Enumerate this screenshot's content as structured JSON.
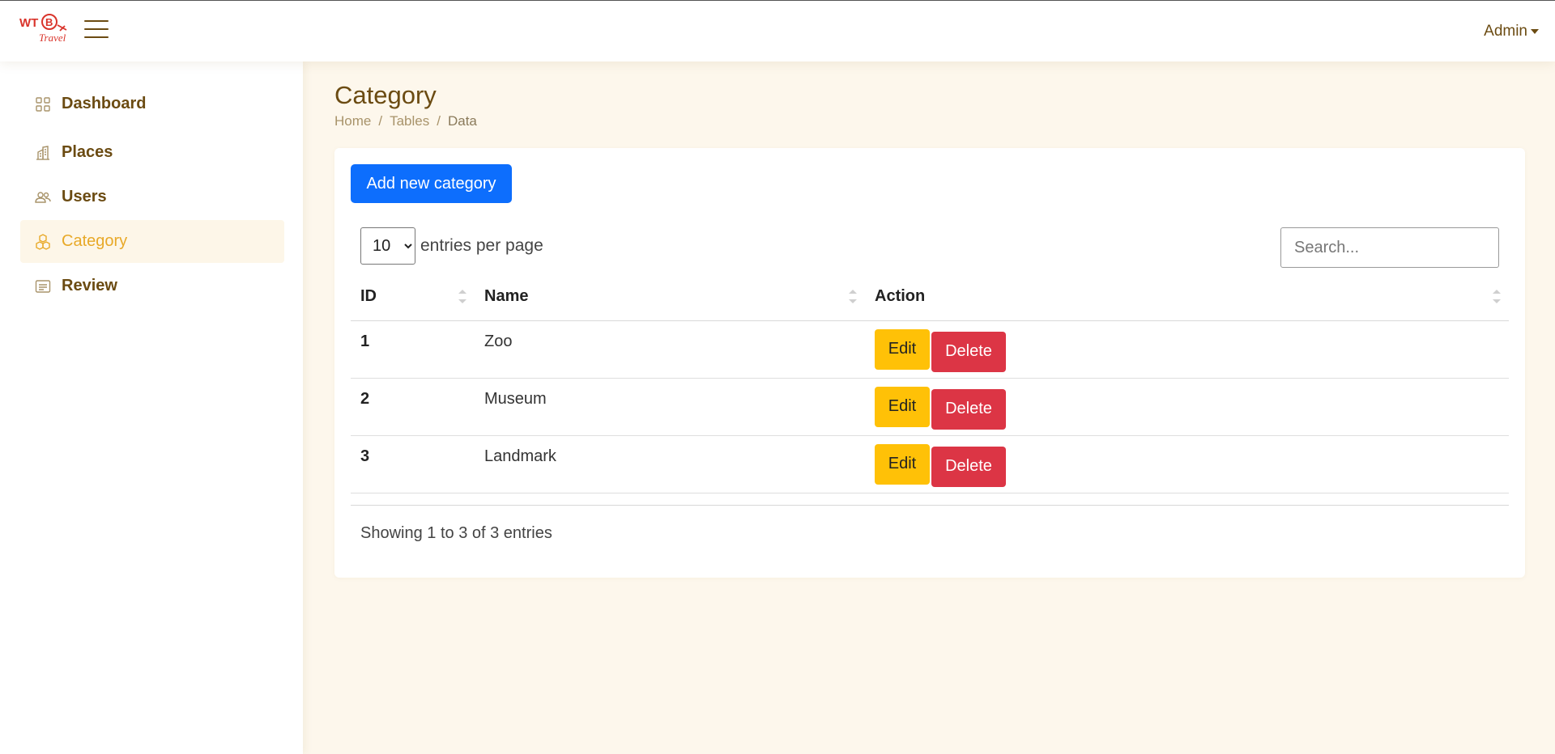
{
  "brand": {
    "logo_text_top": "WTB",
    "logo_text_bottom": "Travel",
    "logo_color": "#d9342b"
  },
  "header": {
    "user_label": "Admin"
  },
  "sidebar": {
    "items": [
      {
        "label": "Dashboard",
        "icon": "grid-icon",
        "active": false
      },
      {
        "label": "Places",
        "icon": "buildings-icon",
        "active": false
      },
      {
        "label": "Users",
        "icon": "people-icon",
        "active": false
      },
      {
        "label": "Category",
        "icon": "boxes-icon",
        "active": true
      },
      {
        "label": "Review",
        "icon": "card-text-icon",
        "active": false
      }
    ]
  },
  "page": {
    "title": "Category",
    "breadcrumb": [
      "Home",
      "Tables",
      "Data"
    ]
  },
  "toolbar": {
    "add_label": "Add new category",
    "entries_value": "10",
    "entries_suffix": "entries per page",
    "search_placeholder": "Search..."
  },
  "table": {
    "columns": [
      "ID",
      "Name",
      "Action"
    ],
    "rows": [
      {
        "id": "1",
        "name": "Zoo",
        "edit": "Edit",
        "delete": "Delete"
      },
      {
        "id": "2",
        "name": "Museum",
        "edit": "Edit",
        "delete": "Delete"
      },
      {
        "id": "3",
        "name": "Landmark",
        "edit": "Edit",
        "delete": "Delete"
      }
    ],
    "info": "Showing 1 to 3 of 3 entries"
  },
  "colors": {
    "primary": "#0d6efd",
    "warning": "#ffc107",
    "danger": "#dc3545",
    "brown": "#6b4b12",
    "accent": "#e8a928",
    "main_bg": "#fdf7ec"
  }
}
